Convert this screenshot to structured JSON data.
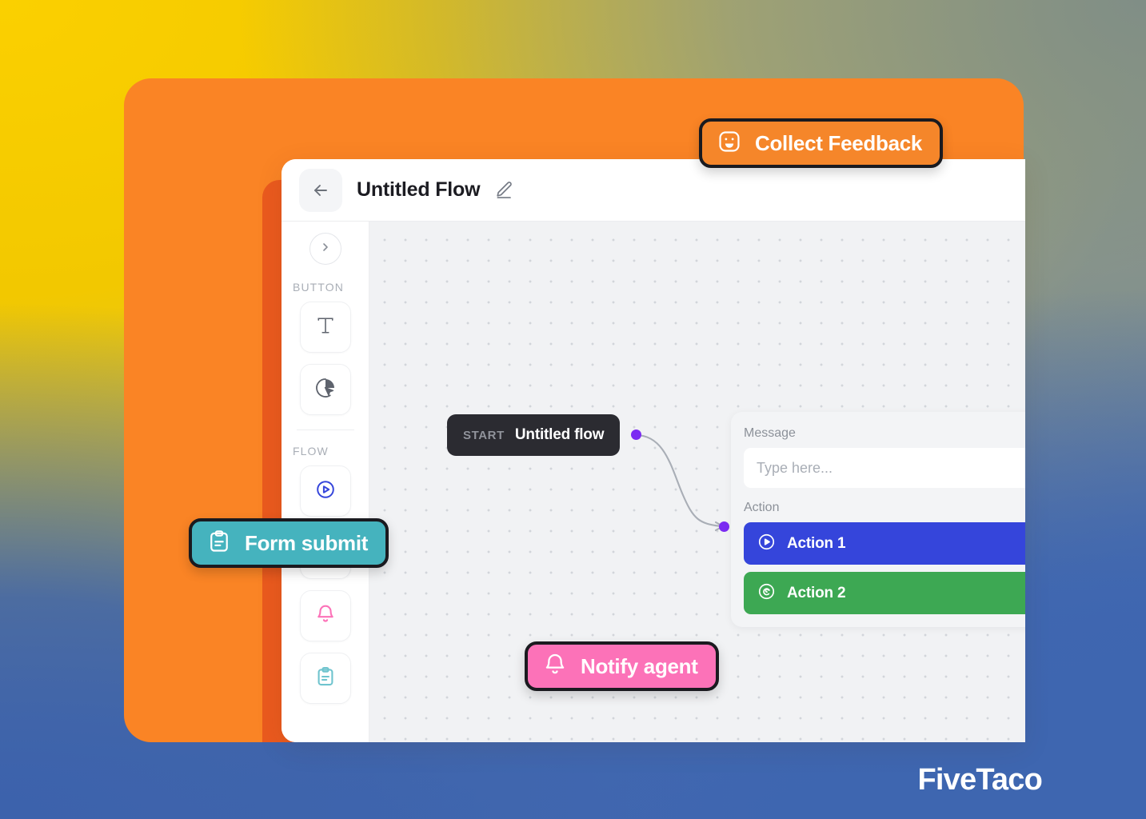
{
  "brand": {
    "name": "FiveTaco"
  },
  "colors": {
    "orange_card": "#FA8425",
    "orange_strip": "#EA5A1E",
    "pill_collect": "#F5862A",
    "pill_form": "#45B3BE",
    "pill_notify": "#FC72B8",
    "action1": "#3545DB",
    "action2": "#3DA853",
    "port": "#7B2BF2",
    "start_node": "#2B2B31",
    "canvas": "#F1F2F4"
  },
  "header": {
    "back_icon": "arrow-left-icon",
    "title": "Untitled Flow",
    "edit_icon": "pencil-icon"
  },
  "sidebar": {
    "collapse_icon": "chevron-right-icon",
    "sections": [
      {
        "label": "BUTTON",
        "tools": [
          {
            "icon": "text-icon",
            "name": "text-tool"
          },
          {
            "icon": "cursor-click-icon",
            "name": "cursor-tool"
          }
        ]
      },
      {
        "label": "FLOW",
        "tools": [
          {
            "icon": "action-play-icon",
            "name": "action-tool",
            "color": "#3545DB"
          },
          {
            "icon": "smiley-icon",
            "name": "feedback-tool",
            "color": "#F5862A"
          },
          {
            "icon": "bell-icon",
            "name": "notify-tool",
            "color": "#FC72B8"
          },
          {
            "icon": "clipboard-icon",
            "name": "form-tool",
            "color": "#45B3BE"
          }
        ]
      }
    ]
  },
  "canvas": {
    "start_node": {
      "kicker": "START",
      "name": "Untitled flow"
    },
    "panel": {
      "message_label": "Message",
      "message_value": "",
      "message_placeholder": "Type here...",
      "action_label": "Action",
      "actions": [
        {
          "label": "Action 1",
          "icon": "play-circle-icon",
          "color": "#3545DB"
        },
        {
          "label": "Action 2",
          "icon": "target-swirl-icon",
          "color": "#3DA853"
        }
      ]
    }
  },
  "pills": [
    {
      "id": "collect",
      "label": "Collect Feedback",
      "icon": "smiley-square-icon"
    },
    {
      "id": "form",
      "label": "Form submit",
      "icon": "clipboard-icon"
    },
    {
      "id": "notify",
      "label": "Notify agent",
      "icon": "bell-icon"
    }
  ]
}
